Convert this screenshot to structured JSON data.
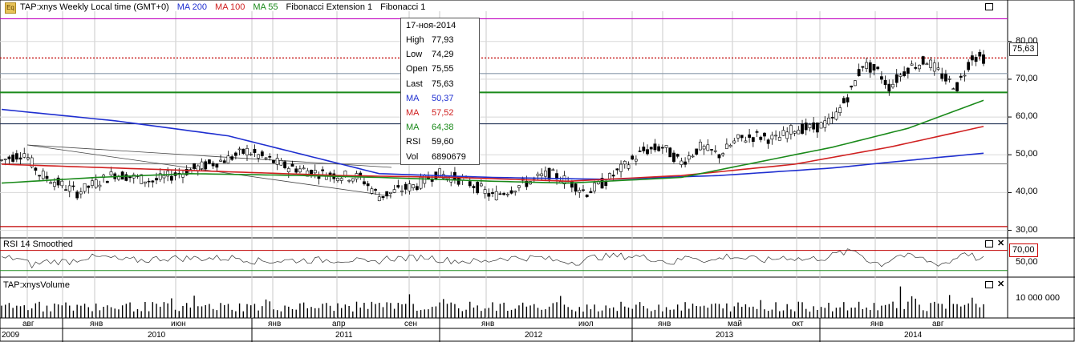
{
  "header": {
    "instrument": "TAP:xnys Weekly Local time (GMT+0)",
    "ma200_label": "MA 200",
    "ma100_label": "MA 100",
    "ma55_label": "MA 55",
    "fib_ext_label": "Fibonacci Extension 1",
    "fib_label": "Fibonacci 1",
    "icon": "app-icon"
  },
  "tooltip": {
    "date": "17-ноя-2014",
    "rows": [
      {
        "k": "High",
        "v": "77,93",
        "color": "#000000"
      },
      {
        "k": "Low",
        "v": "74,29",
        "color": "#000000"
      },
      {
        "k": "Open",
        "v": "75,55",
        "color": "#000000"
      },
      {
        "k": "Last",
        "v": "75,63",
        "color": "#000000"
      },
      {
        "k": "MA",
        "v": "50,37",
        "color": "#1f2fd0"
      },
      {
        "k": "MA",
        "v": "57,52",
        "color": "#d02020"
      },
      {
        "k": "MA",
        "v": "64,38",
        "color": "#1a8a1a"
      },
      {
        "k": "RSI",
        "v": "59,60",
        "color": "#000000"
      },
      {
        "k": "Vol",
        "v": "6890679",
        "color": "#000000"
      }
    ]
  },
  "last_price_tag": "75,63",
  "rsi_panel": {
    "title": "RSI 14 Smoothed",
    "tag": "70,00",
    "ticks": [
      "50,00"
    ]
  },
  "volume_panel": {
    "title": "TAP:xnysVolume",
    "ticks": [
      "10 000 000"
    ]
  },
  "price_ticks": [
    "80,00",
    "70,00",
    "60,00",
    "50,00",
    "40,00",
    "30,00"
  ],
  "x_month_ticks": [
    "авг",
    "янв",
    "июн",
    "янв",
    "апр",
    "сен",
    "янв",
    "июл",
    "янв",
    "май",
    "окт",
    "янв",
    "авг"
  ],
  "x_year_ticks": [
    "2009",
    "2010",
    "2011",
    "2012",
    "2013",
    "2014"
  ],
  "colors": {
    "ma200": "#1f2fd0",
    "ma100": "#d02020",
    "ma55": "#1a8a1a",
    "fib_magenta": "#c000c0"
  },
  "chart_data": {
    "type": "candlestick",
    "period": "weekly",
    "ylim": [
      28,
      88
    ],
    "horizontal_levels": [
      {
        "value": 86,
        "color": "#c000c0"
      },
      {
        "value": 75.63,
        "color": "#c00000",
        "style": "dotted"
      },
      {
        "value": 71.5,
        "color": "#8899aa"
      },
      {
        "value": 66.5,
        "color": "#1a8a1a"
      },
      {
        "value": 58.2,
        "color": "#223355"
      },
      {
        "value": 47.6,
        "color": "#888888"
      },
      {
        "value": 31,
        "color": "#c00000"
      }
    ],
    "price_anchors": [
      [
        0,
        48.5
      ],
      [
        6,
        50.5
      ],
      [
        10,
        45
      ],
      [
        20,
        40
      ],
      [
        30,
        45
      ],
      [
        40,
        43
      ],
      [
        50,
        46
      ],
      [
        60,
        49
      ],
      [
        65,
        51
      ],
      [
        75,
        47
      ],
      [
        85,
        45
      ],
      [
        95,
        44
      ],
      [
        100,
        39
      ],
      [
        110,
        42
      ],
      [
        115,
        45
      ],
      [
        120,
        44
      ],
      [
        125,
        42
      ],
      [
        130,
        39
      ],
      [
        140,
        43
      ],
      [
        145,
        45
      ],
      [
        150,
        43
      ],
      [
        155,
        40
      ],
      [
        160,
        43
      ],
      [
        170,
        51
      ],
      [
        175,
        52
      ],
      [
        180,
        48
      ],
      [
        185,
        52
      ],
      [
        190,
        50
      ],
      [
        195,
        54
      ],
      [
        200,
        55
      ],
      [
        205,
        54
      ],
      [
        210,
        57
      ],
      [
        215,
        57
      ],
      [
        220,
        59
      ],
      [
        225,
        67
      ],
      [
        228,
        74
      ],
      [
        232,
        72
      ],
      [
        235,
        68
      ],
      [
        240,
        73
      ],
      [
        245,
        75
      ],
      [
        250,
        70
      ],
      [
        253,
        68
      ],
      [
        257,
        76
      ],
      [
        260,
        75.6
      ]
    ],
    "ma200": [
      [
        0,
        62
      ],
      [
        30,
        59
      ],
      [
        60,
        55
      ],
      [
        80,
        50
      ],
      [
        100,
        45
      ],
      [
        130,
        44
      ],
      [
        160,
        43.5
      ],
      [
        190,
        44.5
      ],
      [
        220,
        46.5
      ],
      [
        245,
        49
      ],
      [
        260,
        50.4
      ]
    ],
    "ma100": [
      [
        0,
        47.5
      ],
      [
        30,
        46.5
      ],
      [
        60,
        45.5
      ],
      [
        90,
        44.5
      ],
      [
        120,
        44
      ],
      [
        150,
        43
      ],
      [
        180,
        44.5
      ],
      [
        210,
        47.5
      ],
      [
        235,
        52
      ],
      [
        260,
        57.5
      ]
    ],
    "ma55": [
      [
        0,
        42.5
      ],
      [
        25,
        44
      ],
      [
        50,
        45
      ],
      [
        80,
        44.5
      ],
      [
        100,
        44
      ],
      [
        130,
        43
      ],
      [
        150,
        42.5
      ],
      [
        180,
        44
      ],
      [
        200,
        48
      ],
      [
        220,
        52
      ],
      [
        240,
        57
      ],
      [
        260,
        64.4
      ]
    ],
    "volume_max": 15000000,
    "rsi_range": [
      20,
      90
    ]
  }
}
